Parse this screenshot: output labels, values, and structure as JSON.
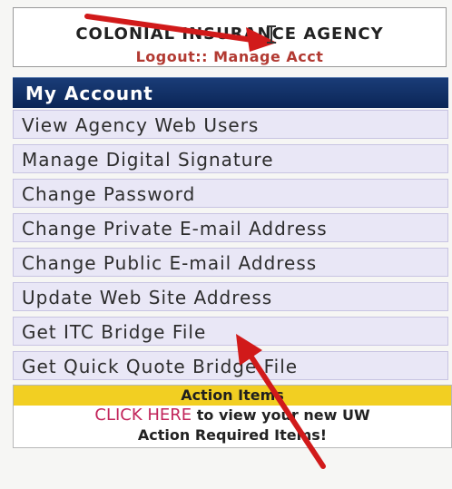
{
  "agency": {
    "name": "COLONIAL INSURANCE AGENCY",
    "logout_label": "Logout::",
    "manage_label": "Manage Acct"
  },
  "menu": {
    "title": "My Account",
    "items": [
      {
        "label": "View Agency Web Users"
      },
      {
        "label": "Manage Digital Signature"
      },
      {
        "label": "Change Password"
      },
      {
        "label": "Change Private E-mail Address"
      },
      {
        "label": "Change Public E-mail Address"
      },
      {
        "label": "Update Web Site Address"
      },
      {
        "label": "Get ITC Bridge File"
      },
      {
        "label": "Get Quick Quote Bridge File"
      }
    ]
  },
  "action_items": {
    "title": "Action Items",
    "link_label": "CLICK HERE",
    "text_1": "to view your new UW",
    "text_2": "Action Required Items!"
  },
  "colors": {
    "header_bg": "#0b2656",
    "menu_item_bg": "#e9e7f6",
    "action_title_bg": "#f2cf22",
    "link_red": "#c2245a",
    "annotation_arrow": "#d11a1a"
  },
  "icons": [
    "annotation-arrow-icon",
    "text-cursor-icon"
  ]
}
